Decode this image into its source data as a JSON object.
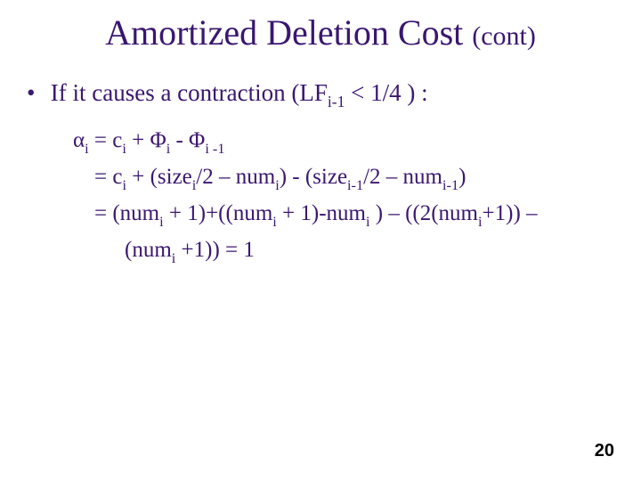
{
  "title_main": "Amortized Deletion Cost",
  "title_cont": "(cont)",
  "bullet": "If it causes a contraction (LF",
  "bullet_sub": "i-1",
  "bullet_tail": " < 1/4 ) :",
  "l1_a": "α",
  "l1_sub1": "i",
  "l1_b": " = c",
  "l1_sub2": "i",
  "l1_c": "  +  Φ",
  "l1_sub3": "i",
  "l1_d": "  -  Φ",
  "l1_sub4": "i -1",
  "l2_a": "= c",
  "l2_sub1": "i",
  "l2_b": " + (size",
  "l2_sub2": "i",
  "l2_c": "/2 – num",
  "l2_sub3": "i",
  "l2_d": ") - (size",
  "l2_sub4": "i-1",
  "l2_e": "/2 – num",
  "l2_sub5": "i-1",
  "l2_f": ")",
  "l3_a": "= (num",
  "l3_sub1": "i",
  "l3_b": " + 1)+((num",
  "l3_sub2": "i",
  "l3_c": " + 1)-num",
  "l3_sub3": "i",
  "l3_d": " ) – ((2(num",
  "l3_sub4": "i",
  "l3_e": "+1)) –",
  "l4_a": "(num",
  "l4_sub1": "i",
  "l4_b": " +1)) =  1",
  "page_number": "20"
}
